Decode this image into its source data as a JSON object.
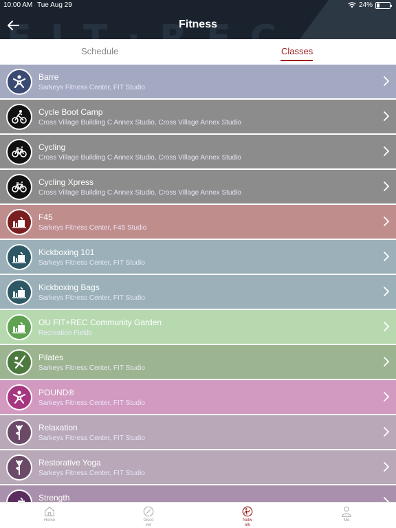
{
  "status": {
    "time": "10:00 AM",
    "date": "Tue Aug 29",
    "battery": "24%",
    "battery_level": 0.24
  },
  "header": {
    "title": "Fitness",
    "back_icon": "arrow-left-icon"
  },
  "tabs": [
    {
      "label": "Schedule",
      "active": false
    },
    {
      "label": "Classes",
      "active": true
    }
  ],
  "classes": [
    {
      "name": "Barre",
      "location": "Sarkeys Fitness Center, FIT Studio",
      "color": "#a4a9c2",
      "icon_color": "#3a4a73",
      "icon": "person-jumping-icon"
    },
    {
      "name": "Cycle Boot Camp",
      "location": "Cross Village Building C Annex Studio, Cross Village Annex Studio",
      "color": "#8c8c8c",
      "icon_color": "#111111",
      "icon": "bicycle-rider-icon"
    },
    {
      "name": "Cycling",
      "location": "Cross Village Building C Annex Studio, Cross Village Annex Studio",
      "color": "#8c8c8c",
      "icon_color": "#111111",
      "icon": "bicycle-icon"
    },
    {
      "name": "Cycling Xpress",
      "location": "Cross Village Building C Annex Studio, Cross Village Annex Studio",
      "color": "#8c8c8c",
      "icon_color": "#111111",
      "icon": "bicycle-icon"
    },
    {
      "name": "F45",
      "location": "Sarkeys Fitness Center, F45 Studio",
      "color": "#c08d8d",
      "icon_color": "#7a1f1f",
      "icon": "weights-icon"
    },
    {
      "name": "Kickboxing 101",
      "location": "Sarkeys Fitness Center, FIT Studio",
      "color": "#9bb0b9",
      "icon_color": "#2e5866",
      "icon": "weights-icon"
    },
    {
      "name": "Kickboxing Bags",
      "location": "Sarkeys Fitness Center, FIT Studio",
      "color": "#9bb0b9",
      "icon_color": "#2e5866",
      "icon": "weights-icon"
    },
    {
      "name": "OU FIT+REC Community Garden",
      "location": "Recreation Fields",
      "color": "#b7d9b0",
      "icon_color": "#5ea252",
      "icon": "weights-icon"
    },
    {
      "name": "Pilates",
      "location": "Sarkeys Fitness Center, FIT Studio",
      "color": "#9db491",
      "icon_color": "#4d7a3f",
      "icon": "pilates-icon"
    },
    {
      "name": "POUND®",
      "location": "Sarkeys Fitness Center, FIT Studio",
      "color": "#d29ac0",
      "icon_color": "#a5367f",
      "icon": "person-jumping-icon"
    },
    {
      "name": "Relaxation",
      "location": "Sarkeys Fitness Center, FIT Studio",
      "color": "#b8a8b8",
      "icon_color": "#6a4a66",
      "icon": "yoga-pose-icon"
    },
    {
      "name": "Restorative Yoga",
      "location": "Sarkeys Fitness Center, FIT Studio",
      "color": "#b8a8b8",
      "icon_color": "#6a4a66",
      "icon": "yoga-pose-icon"
    },
    {
      "name": "Strength",
      "location": "",
      "color": "#a990ac",
      "icon_color": "#5a2d5e",
      "icon": "weights-icon"
    }
  ],
  "tabbar": [
    {
      "label_line1": "Home",
      "label_line2": "",
      "icon": "home-icon",
      "active": false
    },
    {
      "label_line1": "Disco",
      "label_line2": "ver",
      "icon": "compass-icon",
      "active": false
    },
    {
      "label_line1": "Netw",
      "label_line2": "ork",
      "icon": "network-icon",
      "active": true
    },
    {
      "label_line1": "Me",
      "label_line2": "",
      "icon": "person-icon",
      "active": false
    }
  ]
}
